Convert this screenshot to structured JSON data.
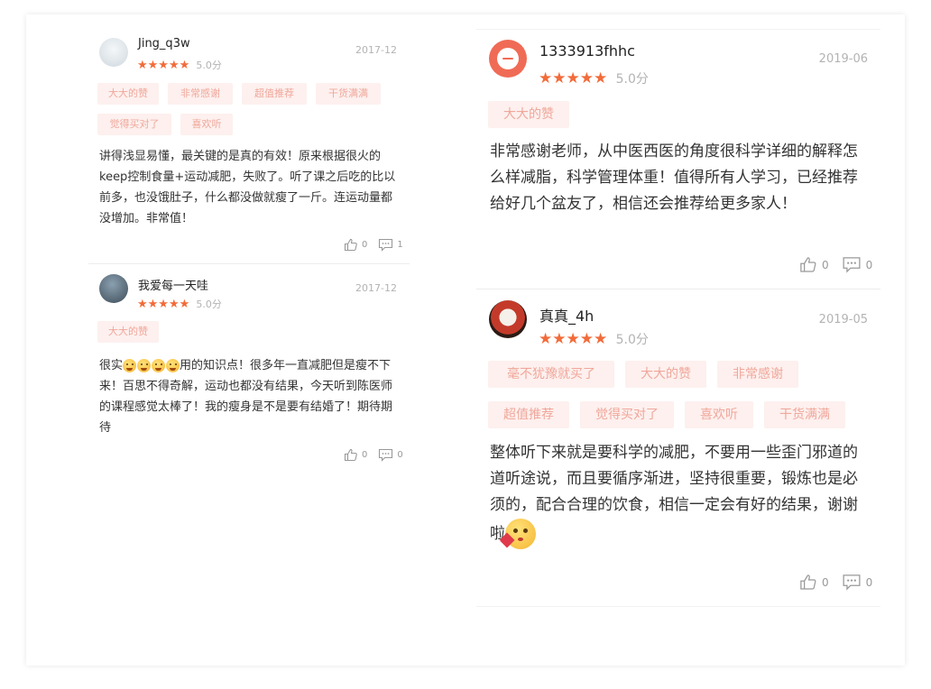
{
  "reviews": [
    {
      "user": "Jing_q3w",
      "date": "2017-12",
      "stars": "★★★★★",
      "score": "5.0分",
      "tags": [
        "大大的赞",
        "非常感谢",
        "超值推荐",
        "干货满满",
        "觉得买对了",
        "喜欢听"
      ],
      "text": "讲得浅显易懂，最关键的是真的有效！原来根据很火的keep控制食量+运动减肥，失败了。听了课之后吃的比以前多，也没饿肚子，什么都没做就瘦了一斤。连运动量都没增加。非常值！",
      "likes": "0",
      "comments": "1",
      "avatar_color": "#dfe6ea"
    },
    {
      "user": "我爱每一天哇",
      "date": "2017-12",
      "stars": "★★★★★",
      "score": "5.0分",
      "tags": [
        "大大的赞"
      ],
      "text_before": "很实",
      "text_after": "用的知识点！很多年一直减肥但是瘦不下来！百思不得奇解，运动也都没有结果，今天听到陈医师的课程感觉太棒了！我的瘦身是不是要有结婚了！期待期待",
      "likes": "0",
      "comments": "0",
      "avatar_color": "#6b7f8f"
    },
    {
      "user": "1333913fhhc",
      "date": "2019-06",
      "stars": "★★★★★",
      "score": "5.0分",
      "tags": [
        "大大的赞"
      ],
      "text": "非常感谢老师，从中医西医的角度很科学详细的解释怎么样减脂，科学管理体重！值得所有人学习，已经推荐给好几个盆友了，相信还会推荐给更多家人！",
      "likes": "0",
      "comments": "0",
      "avatar_color": "#f06b55"
    },
    {
      "user": "真真_4h",
      "date": "2019-05",
      "stars": "★★★★★",
      "score": "5.0分",
      "tags": [
        "毫不犹豫就买了",
        "大大的赞",
        "非常感谢",
        "超值推荐",
        "觉得买对了",
        "喜欢听",
        "干货满满"
      ],
      "text": "整体听下来就是要科学的减肥，不要用一些歪门邪道的道听途说，而且要循序渐进，坚持很重要，锻炼也是必须的，配合合理的饮食，相信一定会有好的结果，谢谢啦",
      "likes": "0",
      "comments": "0",
      "avatar_color": "#c43a2a"
    }
  ]
}
